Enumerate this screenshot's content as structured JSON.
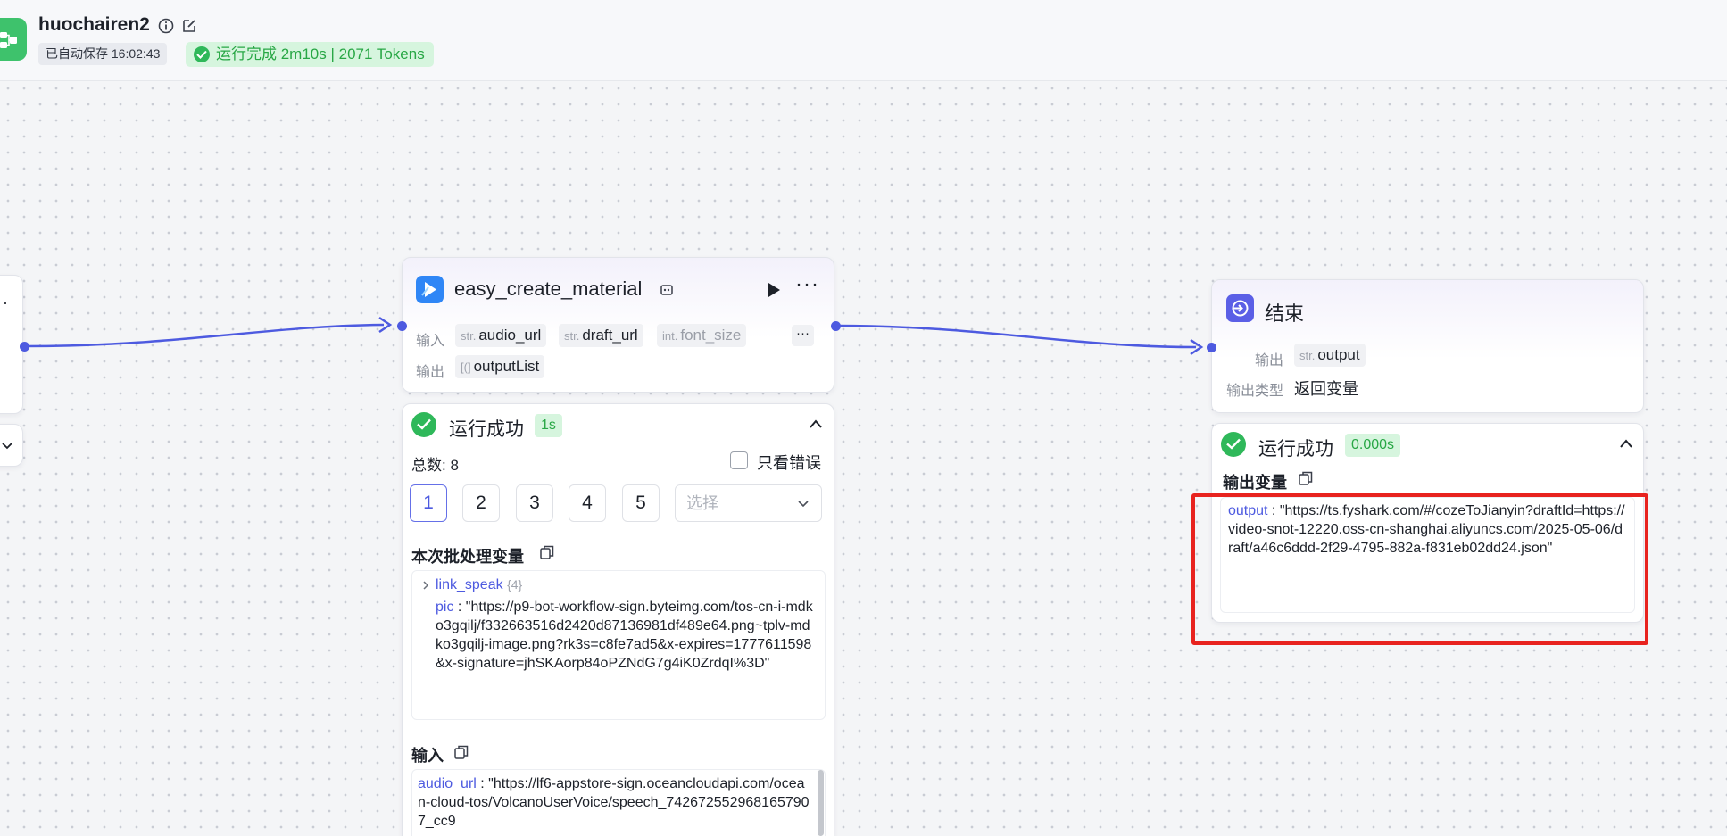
{
  "header": {
    "title": "huochairen2",
    "autosave": "已自动保存 16:02:43",
    "run_status": "运行完成 2m10s | 2071 Tokens",
    "accent": "#3ec26c"
  },
  "node_material": {
    "title": "easy_create_material",
    "input_label": "输入",
    "output_label": "输出",
    "inputs": [
      {
        "type": "str.",
        "name": "audio_url"
      },
      {
        "type": "str.",
        "name": "draft_url"
      },
      {
        "type": "int.",
        "name": "font_size"
      }
    ],
    "more_label": "···",
    "outputs": [
      {
        "type": "[(]",
        "name": "outputList"
      }
    ]
  },
  "result_material": {
    "status": "运行成功",
    "time": "1s",
    "total": "总数: 8",
    "only_errors": "只看错误",
    "pages": [
      "1",
      "2",
      "3",
      "4",
      "5"
    ],
    "select_placeholder": "选择",
    "batch_vars_title": "本次批处理变量",
    "batch_vars": {
      "link_key": "link_speak",
      "link_count": "{4}",
      "pic_key": "pic",
      "pic_value": " : \"https://p9-bot-workflow-sign.byteimg.com/tos-cn-i-mdko3gqilj/f332663516d2420d87136981df489e64.png~tplv-mdko3gqilj-image.png?rk3s=c8fe7ad5&x-expires=1777611598&x-signature=jhSKAorp84oPZNdG7g4iK0ZrdqI%3D\""
    },
    "input_title": "输入",
    "input_key": "audio_url",
    "input_value": " : \"https://lf6-appstore-sign.oceancloudapi.com/ocean-cloud-tos/VolcanoUserVoice/speech_7426725529681657907_cc9"
  },
  "node_end": {
    "title": "结束",
    "output_label": "输出",
    "output_type": "str.",
    "output_name": "output",
    "output_kind_label": "输出类型",
    "output_kind_value": "返回变量"
  },
  "result_end": {
    "status": "运行成功",
    "time": "0.000s",
    "vars_title": "输出变量",
    "output_key": "output",
    "output_value": " : \"https://ts.fyshark.com/#/cozeToJianyin?draftId=https://video-snot-12220.oss-cn-shanghai.aliyuncs.com/2025-05-06/draft/a46c6ddd-2f29-4795-882a-f831eb02dd24.json\""
  },
  "colors": {
    "edge": "#4d5ae0",
    "success": "#2fb85a",
    "highlight": "#e8231f"
  }
}
